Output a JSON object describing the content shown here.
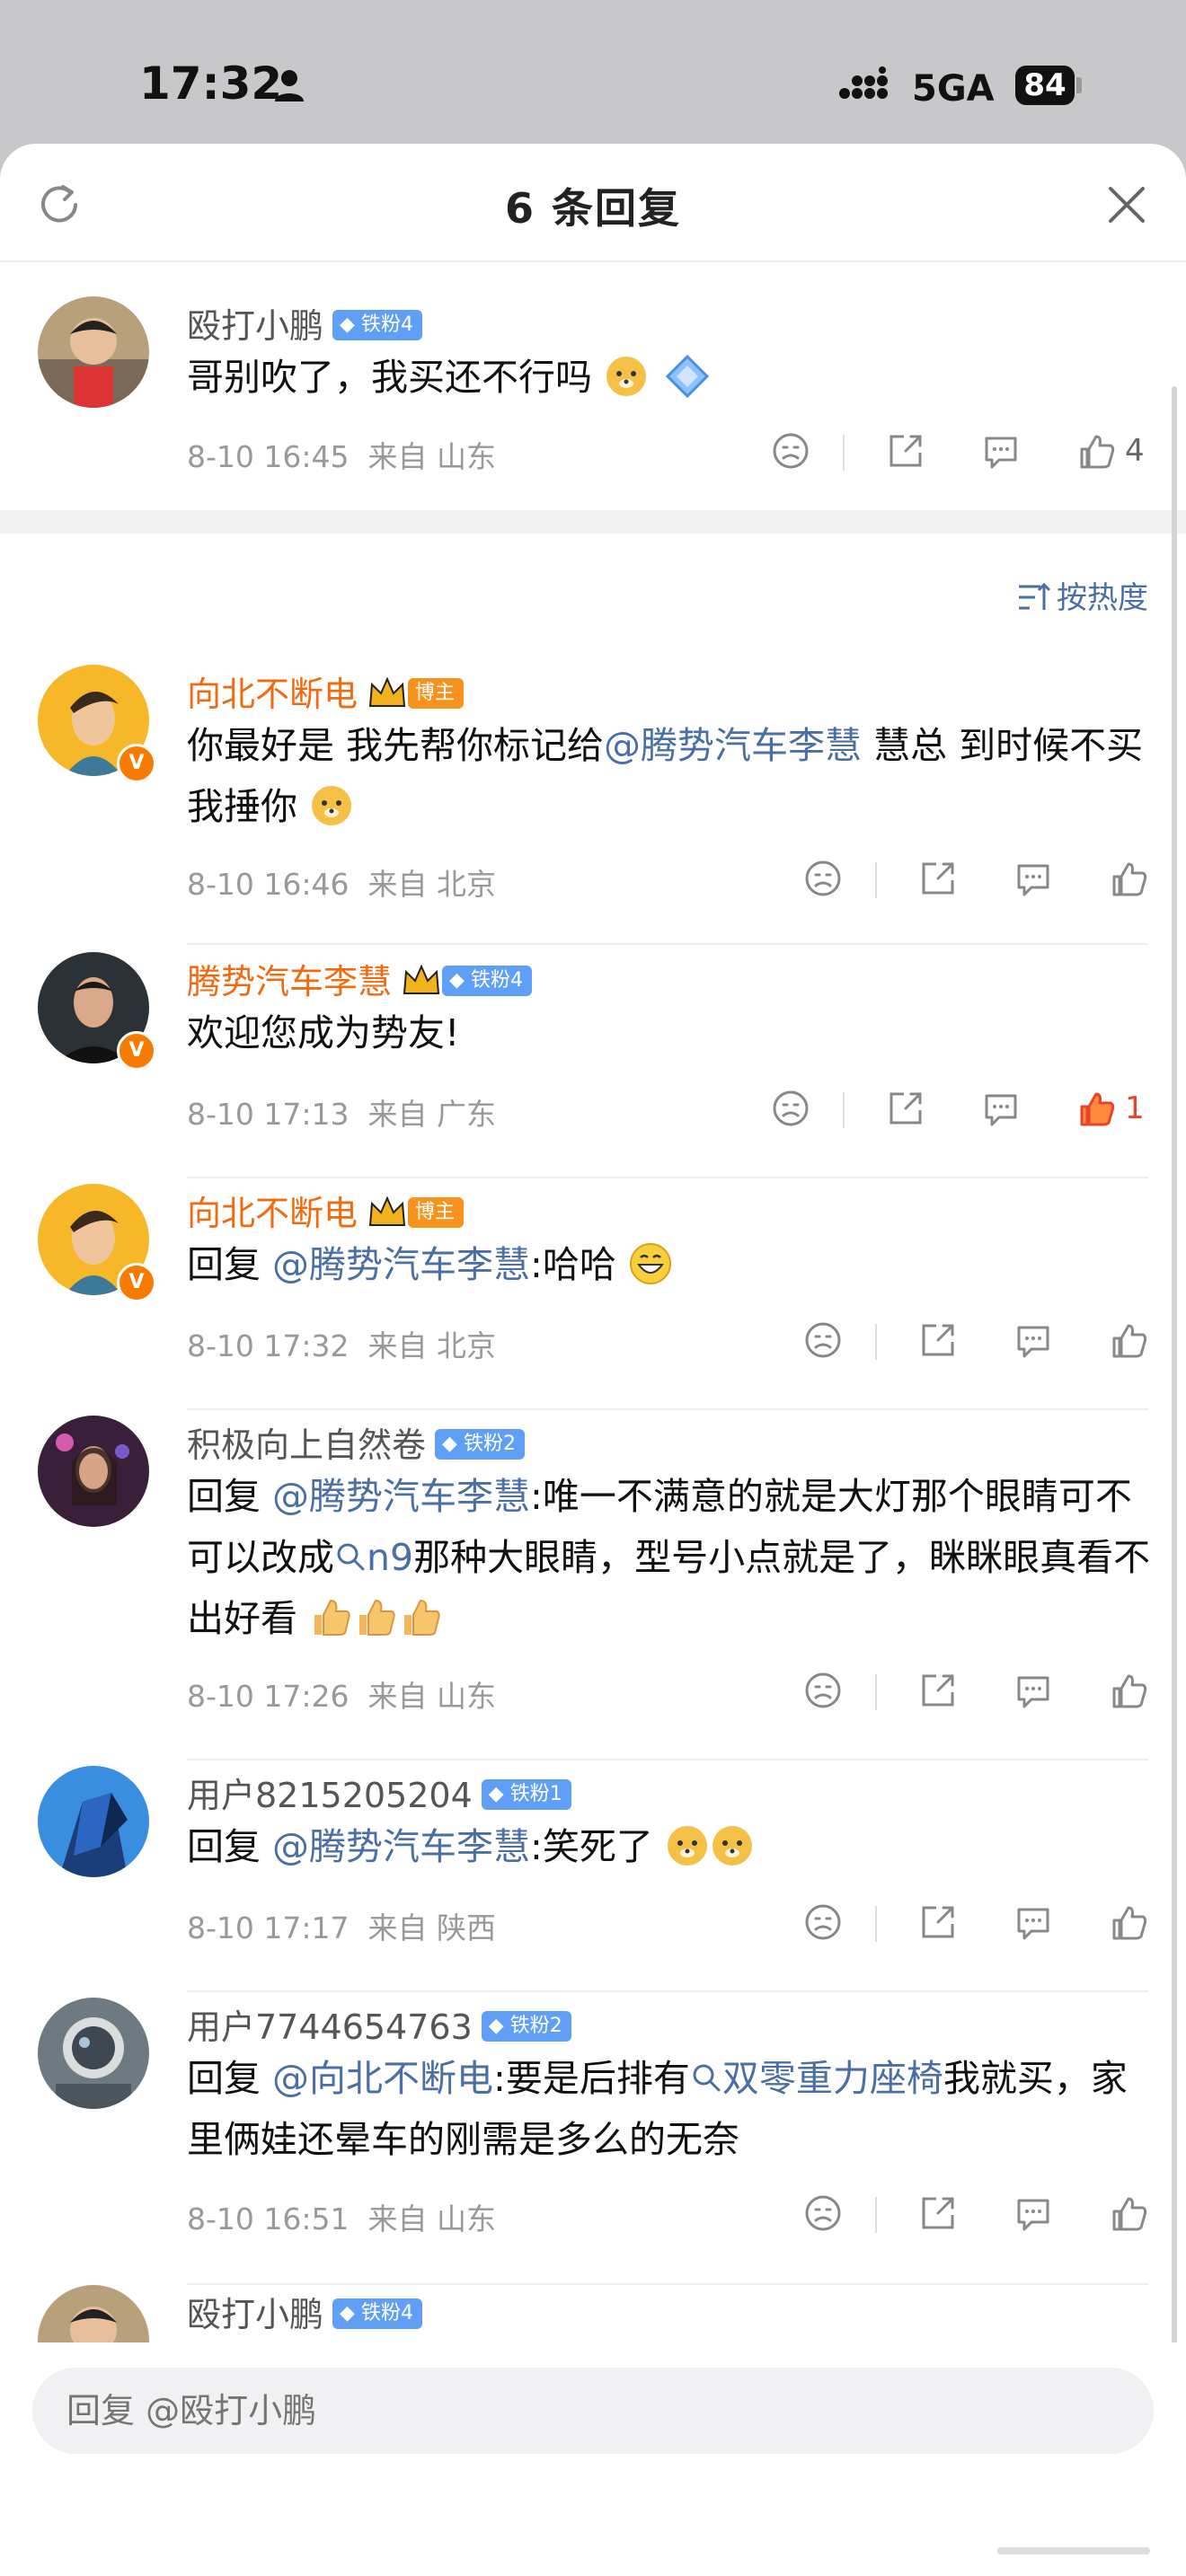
{
  "status_bar": {
    "time": "17:32",
    "network": "5GA",
    "battery": "84"
  },
  "header": {
    "title": "6 条回复"
  },
  "original_comment": {
    "username": "殴打小鹏",
    "badge": "铁粉4",
    "text": "哥别吹了，我买还不行吗",
    "time": "8-10 16:45",
    "location": "来自 山东",
    "likes": "4"
  },
  "sort": {
    "label": "按热度"
  },
  "replies": [
    {
      "username": "向北不断电",
      "badge": "博主",
      "text_a": "你最好是 我先帮你标记给",
      "mention": "@腾势汽车李慧",
      "text_b": " 慧总 到时候不买我捶你",
      "time": "8-10 16:46",
      "location": "来自 北京"
    },
    {
      "username": "腾势汽车李慧",
      "badge": "铁粉4",
      "text_a": "欢迎您成为势友!",
      "time": "8-10 17:13",
      "location": "来自 广东",
      "likes": "1"
    },
    {
      "username": "向北不断电",
      "badge": "博主",
      "text_a": "回复 ",
      "mention": "@腾势汽车李慧",
      "text_b": ":哈哈",
      "time": "8-10 17:32",
      "location": "来自 北京"
    },
    {
      "username": "积极向上自然卷",
      "badge": "铁粉2",
      "text_a": "回复 ",
      "mention": "@腾势汽车李慧",
      "text_b": ":唯一不满意的就是大灯那个眼睛可不可以改成",
      "search_term": "n9",
      "text_c": "那种大眼睛，型号小点就是了，眯眯眼真看不出好看",
      "time": "8-10 17:26",
      "location": "来自 山东"
    },
    {
      "username": "用户8215205204",
      "badge": "铁粉1",
      "text_a": "回复 ",
      "mention": "@腾势汽车李慧",
      "text_b": ":笑死了",
      "time": "8-10 17:17",
      "location": "来自 陕西"
    },
    {
      "username": "用户7744654763",
      "badge": "铁粉2",
      "text_a": "回复 ",
      "mention": "@向北不断电",
      "text_b": ":要是后排有",
      "search_term": "双零重力座椅",
      "text_c": "我就买，家里俩娃还晕车的刚需是多么的无奈",
      "time": "8-10 16:51",
      "location": "来自 山东"
    },
    {
      "username": "殴打小鹏",
      "badge": "铁粉4"
    }
  ],
  "input": {
    "placeholder": "回复 @殴打小鹏"
  },
  "colors": {
    "mention": "#4a6fa5",
    "orange_name": "#f06a0f",
    "fan_badge": "#5f9ff5",
    "blogger_badge": "#f7921c",
    "like_active": "#e8422b"
  }
}
